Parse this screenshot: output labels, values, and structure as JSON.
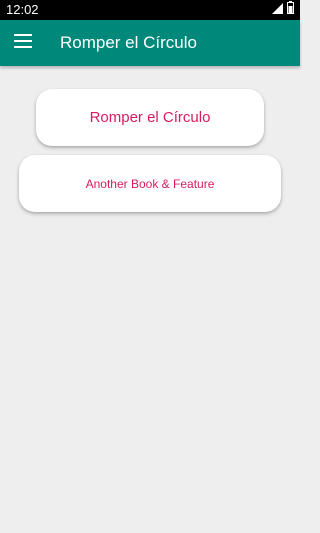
{
  "status_bar": {
    "time": "12:02",
    "icons": [
      "signal-icon",
      "battery-icon"
    ]
  },
  "app_bar": {
    "title": "Romper el Círculo",
    "menu_icon": "hamburger-menu-icon",
    "background_color": "#00897b"
  },
  "cards": [
    {
      "label": "Romper el Círculo"
    },
    {
      "label": "Another Book & Feature"
    }
  ],
  "colors": {
    "accent_text": "#d81b60",
    "page_background": "#eeeeee"
  }
}
